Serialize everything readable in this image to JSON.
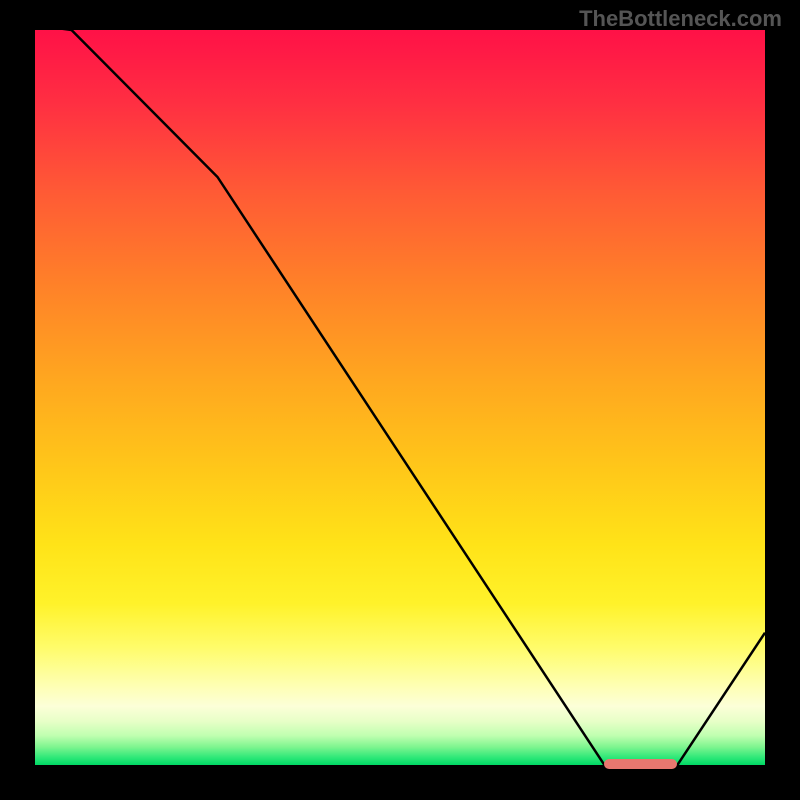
{
  "watermark": "TheBottleneck.com",
  "chart_data": {
    "type": "line",
    "title": "",
    "xlabel": "",
    "ylabel": "",
    "xlim": [
      0,
      100
    ],
    "ylim": [
      0,
      100
    ],
    "x": [
      0,
      5,
      25,
      78,
      88,
      100
    ],
    "values": [
      105,
      100,
      80,
      0,
      0,
      18
    ],
    "marker": {
      "x_start": 78,
      "x_end": 88,
      "y": 0
    },
    "gradient_stops": [
      {
        "pos": 0,
        "color": "#ff1147"
      },
      {
        "pos": 50,
        "color": "#ffc418"
      },
      {
        "pos": 85,
        "color": "#fffc80"
      },
      {
        "pos": 100,
        "color": "#00d864"
      }
    ]
  }
}
